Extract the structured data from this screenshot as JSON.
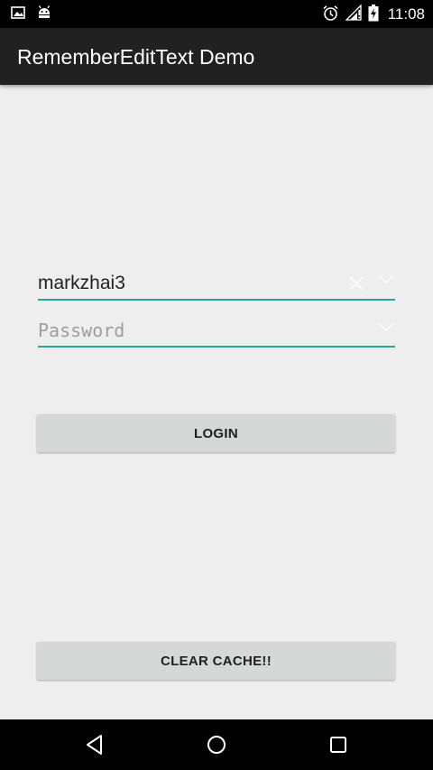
{
  "status_bar": {
    "time": "11:08",
    "icons": [
      "image-icon",
      "android-debug-icon",
      "alarm-icon",
      "signal-icon",
      "battery-charging-icon"
    ]
  },
  "app_bar": {
    "title": "RememberEditText Demo"
  },
  "username": {
    "value": "markzhai3",
    "clear_icon": "close-icon",
    "dropdown_icon": "chevron-down-icon"
  },
  "password": {
    "value": "",
    "placeholder": "Password",
    "dropdown_icon": "chevron-down-icon"
  },
  "buttons": {
    "login": "LOGIN",
    "clear_cache": "CLEAR CACHE!!"
  },
  "colors": {
    "accent": "#26a69a",
    "app_bar": "#212121",
    "background": "#eeeeee",
    "button": "#d6d7d7"
  },
  "nav_bar": {
    "icons": [
      "back-icon",
      "home-icon",
      "recents-icon"
    ]
  }
}
